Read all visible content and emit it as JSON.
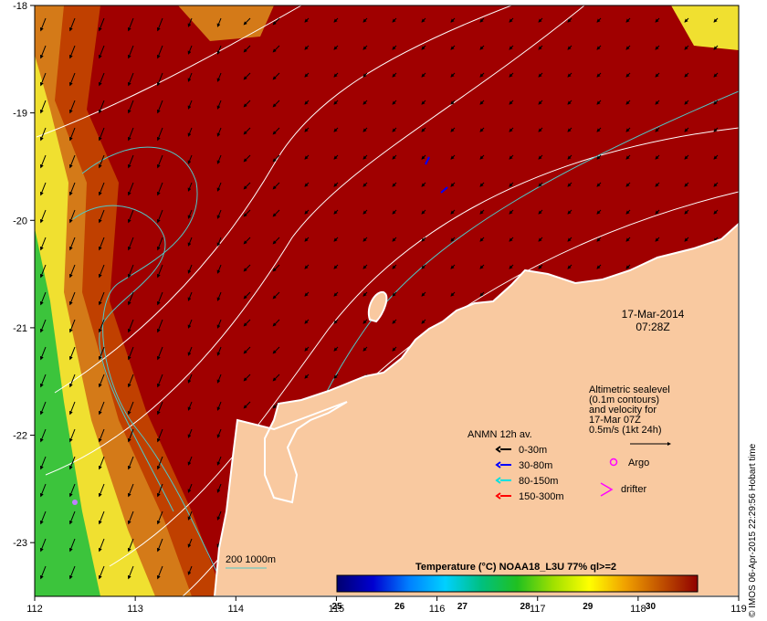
{
  "map": {
    "lon_ticks": [
      "112",
      "113",
      "114",
      "115",
      "116",
      "117",
      "118",
      "119"
    ],
    "lat_ticks": [
      "-18",
      "-19",
      "-20",
      "-21",
      "-22",
      "-23"
    ],
    "lon_range": [
      112,
      119
    ],
    "lat_range": [
      -23.5,
      -18
    ],
    "colors": {
      "land": "#f9c9a0",
      "sst_hot": "#a00000",
      "sst_warm": "#c04000",
      "sst_orange": "#d47a18",
      "sst_yellow": "#f0e030",
      "sst_green": "#3cc43c",
      "contour_white": "#ffffff",
      "isobath_cyan": "#50c8c8",
      "vector": "#000000"
    }
  },
  "date": {
    "line1": "17-Mar-2014",
    "line2": "07:28Z"
  },
  "altimetry": {
    "line1": "Altimetric sealevel",
    "line2": "(0.1m contours)",
    "line3": "and velocity for",
    "line4": "17-Mar 07Z",
    "line5": "0.5m/s (1kt 24h)"
  },
  "legend": {
    "title": "ANMN 12h av.",
    "items": [
      {
        "label": "0-30m",
        "color": "#000000"
      },
      {
        "label": "30-80m",
        "color": "#0000ff"
      },
      {
        "label": "80-150m",
        "color": "#00e0e0"
      },
      {
        "label": "150-300m",
        "color": "#ff0000"
      }
    ],
    "argo": {
      "label": "Argo",
      "color": "#ff00ff"
    },
    "drifter": {
      "label": "drifter",
      "color": "#ff00ff"
    }
  },
  "isobath_label": "200  1000m",
  "colorbar": {
    "title": "Temperature (°C) NOAA18_L3U 77% ql>=2",
    "ticks": [
      "25",
      "26",
      "27",
      "28",
      "29",
      "30"
    ],
    "range": [
      25,
      30.75
    ],
    "stops": [
      "#000070",
      "#0000d0",
      "#0080ff",
      "#00d0ff",
      "#00c080",
      "#20c020",
      "#a0e000",
      "#ffff00",
      "#f0a000",
      "#c05000",
      "#900000"
    ]
  },
  "credit": "© IMOS 06-Apr-2015 22:29:56 Hobart time"
}
